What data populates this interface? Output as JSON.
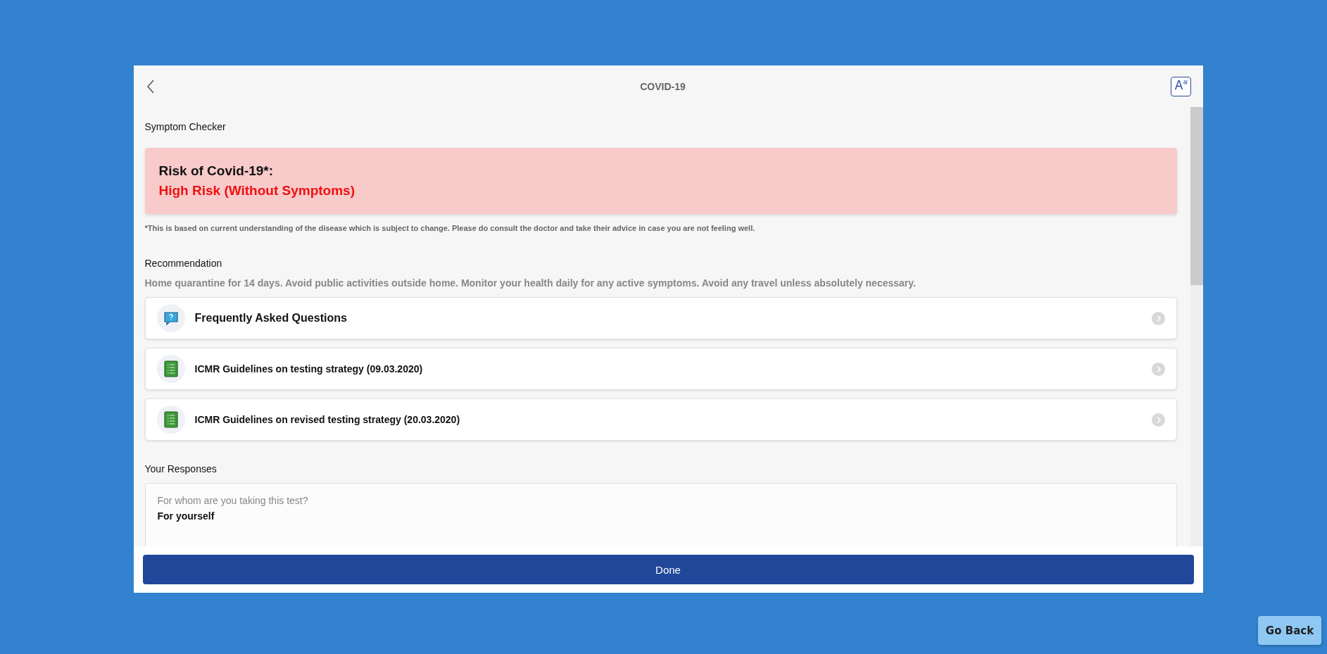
{
  "header": {
    "title": "COVID-19",
    "language_button": {
      "letter": "A",
      "script_letter": "अ"
    }
  },
  "section_title": "Symptom Checker",
  "risk": {
    "label": "Risk of Covid-19*:",
    "value": "High Risk (Without Symptoms)"
  },
  "footnote": "*This is based on current understanding of the disease which is subject to change. Please do consult the doctor and take their advice in case you are not feeling well.",
  "recommendation": {
    "heading": "Recommendation",
    "text": "Home quarantine for 14 days. Avoid public activities outside home. Monitor your health daily for any active symptoms. Avoid any travel unless absolutely necessary."
  },
  "links": [
    {
      "kind": "faq",
      "label": "Frequently Asked Questions"
    },
    {
      "kind": "document",
      "label": "ICMR Guidelines on testing strategy (09.03.2020)"
    },
    {
      "kind": "document",
      "label": "ICMR Guidelines on revised testing strategy (20.03.2020)"
    }
  ],
  "responses": {
    "heading": "Your Responses",
    "items": [
      {
        "question": "For whom are you taking this test?",
        "answer": "For yourself"
      }
    ]
  },
  "done_button": "Done",
  "go_back_button": "Go Back"
}
